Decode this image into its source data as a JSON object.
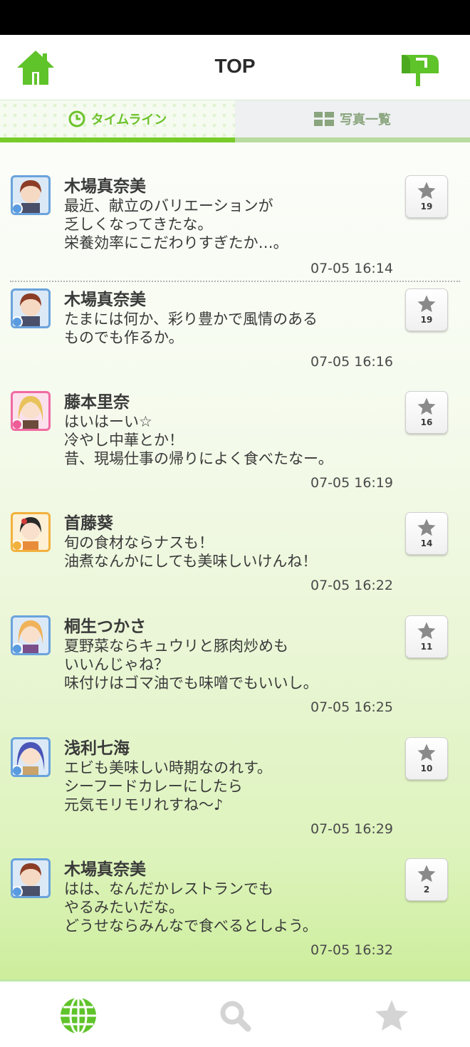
{
  "header": {
    "title": "TOP",
    "home_icon": "home-icon",
    "mail_icon": "mailbox-icon",
    "accent_color": "#77cc2a"
  },
  "tabs": [
    {
      "label": "タイムライン",
      "icon": "clock-icon",
      "active": true
    },
    {
      "label": "写真一覧",
      "icon": "grid-icon",
      "active": false
    }
  ],
  "posts": [
    {
      "author": "木場真奈美",
      "message": "最近、献立のバリエーションが\n乏しくなってきたな。\n栄養効率にこだわりすぎたか…。",
      "time": "07-05 16:14",
      "stars": "19",
      "avatar_color": "blue"
    },
    {
      "author": "木場真奈美",
      "message": "たまには何か、彩り豊かで風情のある\nものでも作るか。",
      "time": "07-05 16:16",
      "stars": "19",
      "avatar_color": "blue"
    },
    {
      "author": "藤本里奈",
      "message": "はいはーい☆\n冷やし中華とか！\n昔、現場仕事の帰りによく食べたなー。",
      "time": "07-05 16:19",
      "stars": "16",
      "avatar_color": "pink"
    },
    {
      "author": "首藤葵",
      "message": "旬の食材ならナスも！\n油煮なんかにしても美味しいけんね！",
      "time": "07-05 16:22",
      "stars": "14",
      "avatar_color": "yellow"
    },
    {
      "author": "桐生つかさ",
      "message": "夏野菜ならキュウリと豚肉炒めも\nいいんじゃね？\n味付けはゴマ油でも味噌でもいいし。",
      "time": "07-05 16:25",
      "stars": "11",
      "avatar_color": "blue"
    },
    {
      "author": "浅利七海",
      "message": "エビも美味しい時期なのれす。\nシーフードカレーにしたら\n元気モリモリれすね〜♪",
      "time": "07-05 16:29",
      "stars": "10",
      "avatar_color": "blue"
    },
    {
      "author": "木場真奈美",
      "message": "はは、なんだかレストランでも\nやるみたいだな。\nどうせならみんなで食べるとしよう。",
      "time": "07-05 16:32",
      "stars": "2",
      "avatar_color": "blue"
    }
  ],
  "bottom_nav": [
    {
      "icon": "globe-icon",
      "active": true
    },
    {
      "icon": "search-icon",
      "active": false
    },
    {
      "icon": "star-icon",
      "active": false
    }
  ]
}
